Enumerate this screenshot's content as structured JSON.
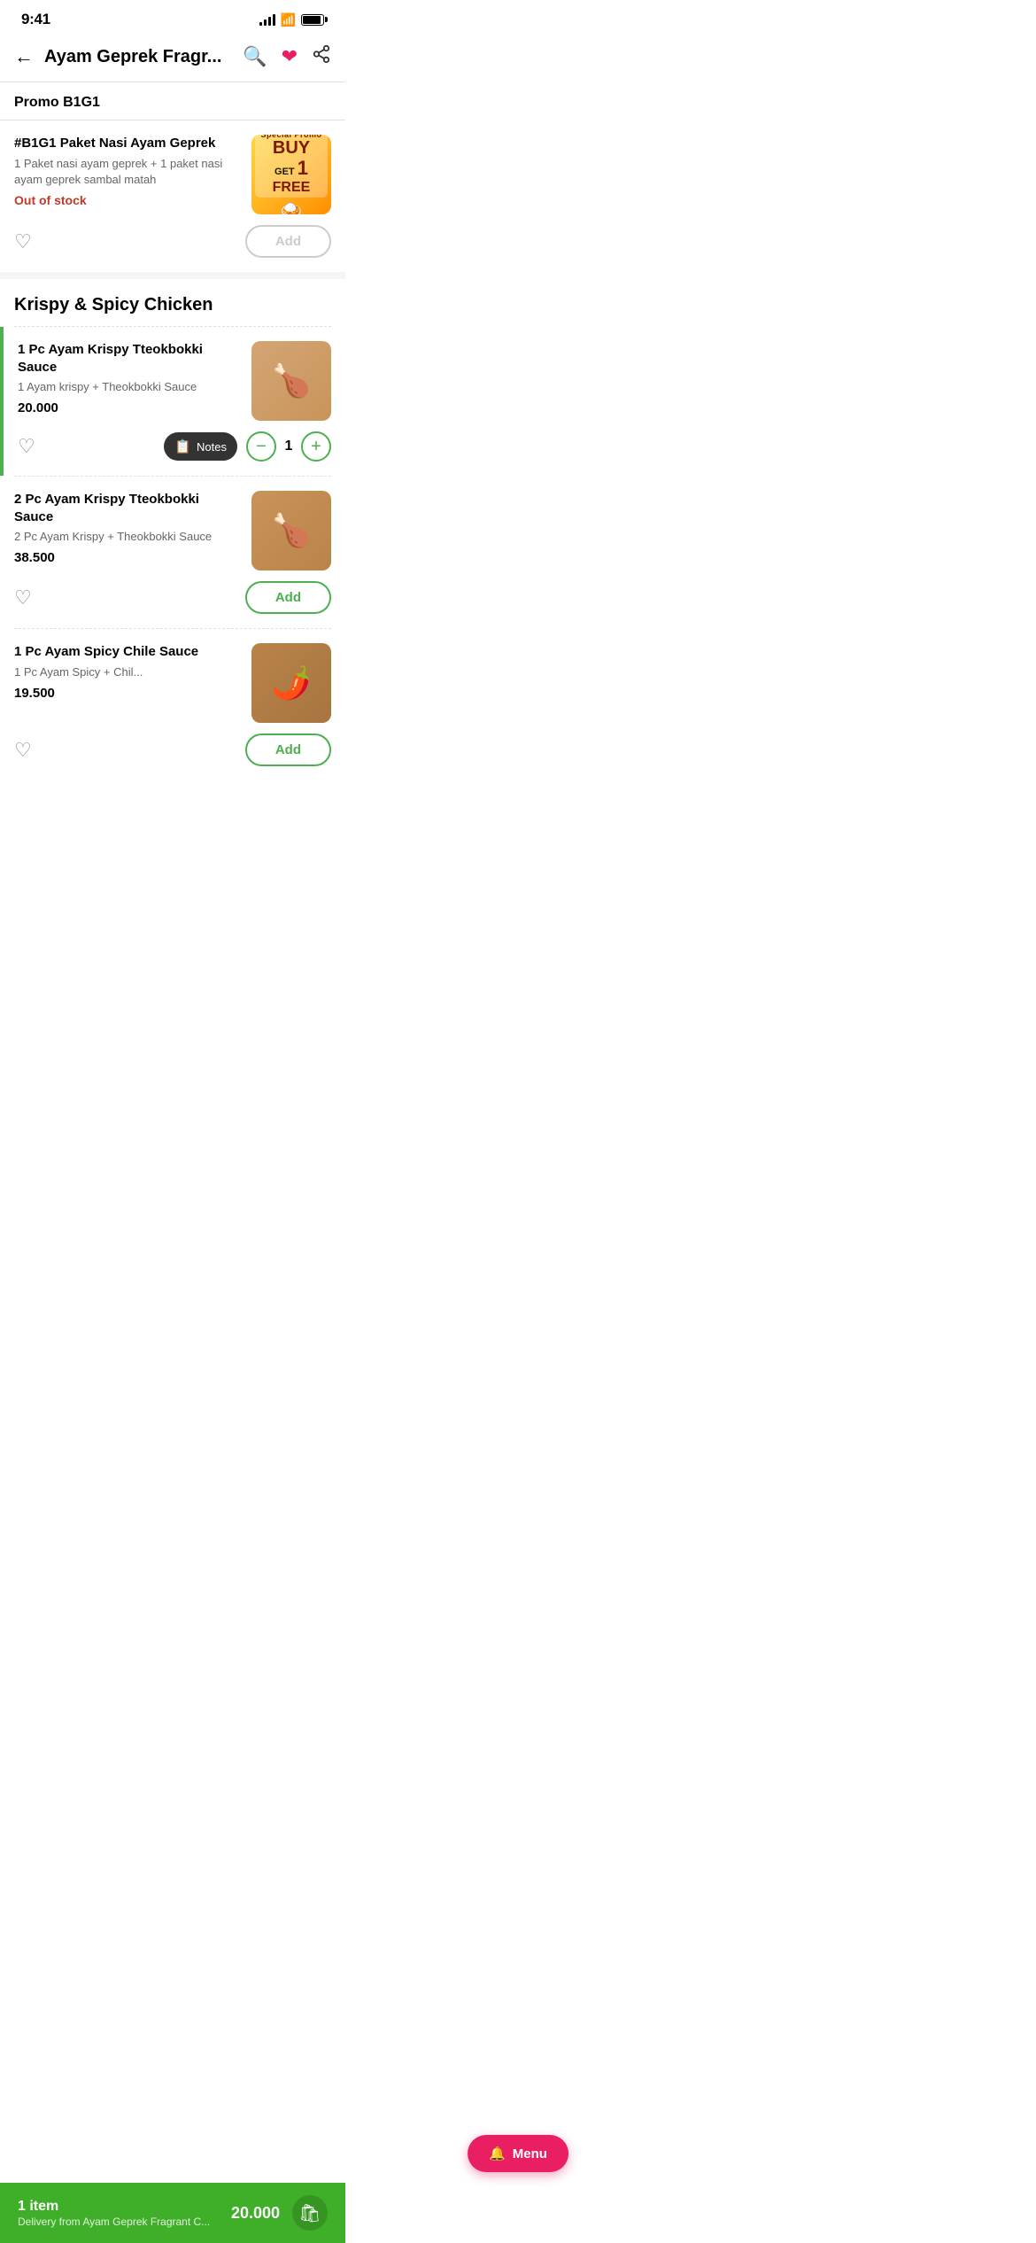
{
  "statusBar": {
    "time": "9:41"
  },
  "header": {
    "title": "Ayam Geprek Fragr...",
    "backLabel": "←",
    "searchIcon": "search",
    "heartIcon": "heart",
    "shareIcon": "share"
  },
  "sections": [
    {
      "id": "promo",
      "label": "Promo B1G1",
      "items": [
        {
          "id": "b1g1",
          "title": "#B1G1 Paket Nasi Ayam Geprek",
          "desc": "1 Paket nasi ayam geprek + 1 paket nasi ayam geprek sambal matah",
          "outOfStock": "Out of stock",
          "price": "",
          "hasImage": true,
          "quantity": 0,
          "liked": false
        }
      ]
    },
    {
      "id": "krispy",
      "label": "Krispy & Spicy Chicken",
      "items": [
        {
          "id": "krispy1pc",
          "title": "1 Pc Ayam Krispy Tteokbokki Sauce",
          "desc": "1 Ayam krispy + Theokbokki Sauce",
          "price": "20.000",
          "quantity": 1,
          "liked": false,
          "hasLeftBar": true
        },
        {
          "id": "krispy2pc",
          "title": "2 Pc Ayam Krispy Tteokbokki Sauce",
          "desc": "2 Pc Ayam Krispy + Theokbokki Sauce",
          "price": "38.500",
          "quantity": 0,
          "liked": false
        },
        {
          "id": "spicy1pc",
          "title": "1 Pc Ayam Spicy Chile Sauce",
          "desc": "1 Pc Ayam Spicy + Chil...",
          "price": "19.500",
          "quantity": 0,
          "liked": false
        }
      ]
    }
  ],
  "notesLabel": "Notes",
  "addLabel": "Add",
  "bottomBar": {
    "itemCount": "1 item",
    "subtitle": "Delivery from Ayam Geprek Fragrant C...",
    "price": "20.000",
    "cartIcon": "cart"
  },
  "menuFloatBtn": {
    "label": "Menu",
    "icon": "menu-bell"
  },
  "quantityValue": "1",
  "outOfStockText": "Out of stock"
}
